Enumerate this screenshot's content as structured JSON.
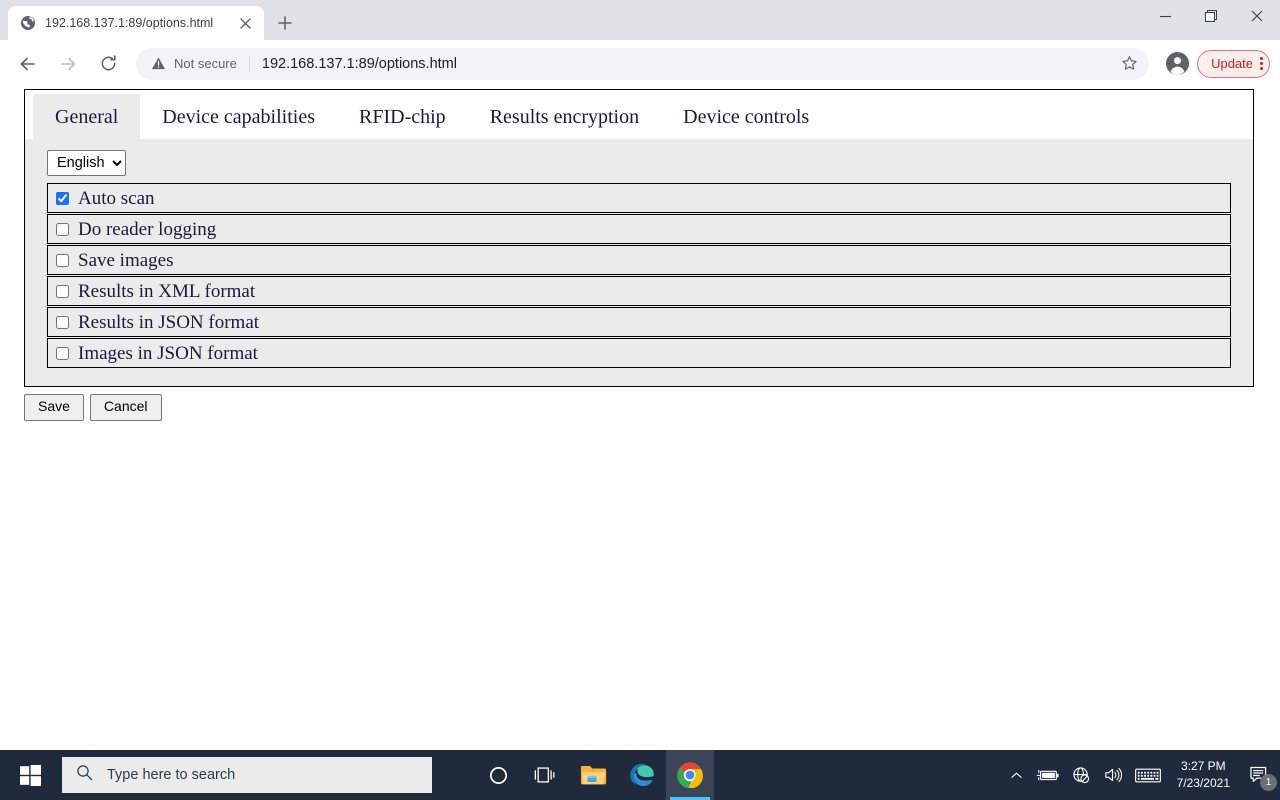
{
  "browser": {
    "tab": {
      "title": "192.168.137.1:89/options.html",
      "favicon": "globe-icon",
      "close": "close-icon"
    },
    "newtab_label": "new-tab-icon",
    "window_controls": {
      "minimize": "minimize-icon",
      "maximize": "maximize-icon",
      "close": "close-window-icon"
    },
    "nav": {
      "back": "back-arrow-icon",
      "forward": "forward-arrow-icon",
      "reload": "reload-icon"
    },
    "omnibox": {
      "security_icon": "warning-triangle-icon",
      "security_text": "Not secure",
      "url": "192.168.137.1:89/options.html",
      "bookmark_icon": "star-icon"
    },
    "profile_icon": "account-avatar-icon",
    "update": {
      "label": "Update",
      "menu_icon": "three-dots-vertical-icon",
      "border_color": "#e57373",
      "text_color": "#c5221f",
      "background": "#fdeeee"
    }
  },
  "page": {
    "tabs": [
      {
        "label": "General",
        "active": true
      },
      {
        "label": "Device capabilities",
        "active": false
      },
      {
        "label": "RFID-chip",
        "active": false
      },
      {
        "label": "Results encryption",
        "active": false
      },
      {
        "label": "Device controls",
        "active": false
      }
    ],
    "language_select": {
      "value": "English",
      "options": [
        "English"
      ],
      "arrow_icon": "chevron-down-icon"
    },
    "options": [
      {
        "label": "Auto scan",
        "checked": true
      },
      {
        "label": "Do reader logging",
        "checked": false
      },
      {
        "label": "Save images",
        "checked": false
      },
      {
        "label": "Results in XML format",
        "checked": false
      },
      {
        "label": "Results in JSON format",
        "checked": false
      },
      {
        "label": "Images in JSON format",
        "checked": false
      }
    ],
    "buttons": {
      "save": "Save",
      "cancel": "Cancel"
    },
    "accent_checked": "#1a73e8",
    "panel_bg": "#ebebeb"
  },
  "taskbar": {
    "start_icon": "windows-start-icon",
    "search": {
      "icon": "search-icon",
      "placeholder": "Type here to search"
    },
    "items": [
      {
        "name": "cortana-icon",
        "active": false
      },
      {
        "name": "task-view-icon",
        "active": false
      },
      {
        "name": "file-explorer-icon",
        "active": false
      },
      {
        "name": "microsoft-edge-icon",
        "active": false
      },
      {
        "name": "google-chrome-icon",
        "active": true
      }
    ],
    "tray": [
      {
        "name": "show-hidden-icons-chevron-icon"
      },
      {
        "name": "battery-charging-icon"
      },
      {
        "name": "network-no-internet-icon"
      },
      {
        "name": "volume-icon"
      },
      {
        "name": "touch-keyboard-icon"
      }
    ],
    "clock": {
      "time": "3:27 PM",
      "date": "7/23/2021"
    },
    "notifications": {
      "icon": "action-center-icon",
      "count": "1"
    }
  }
}
